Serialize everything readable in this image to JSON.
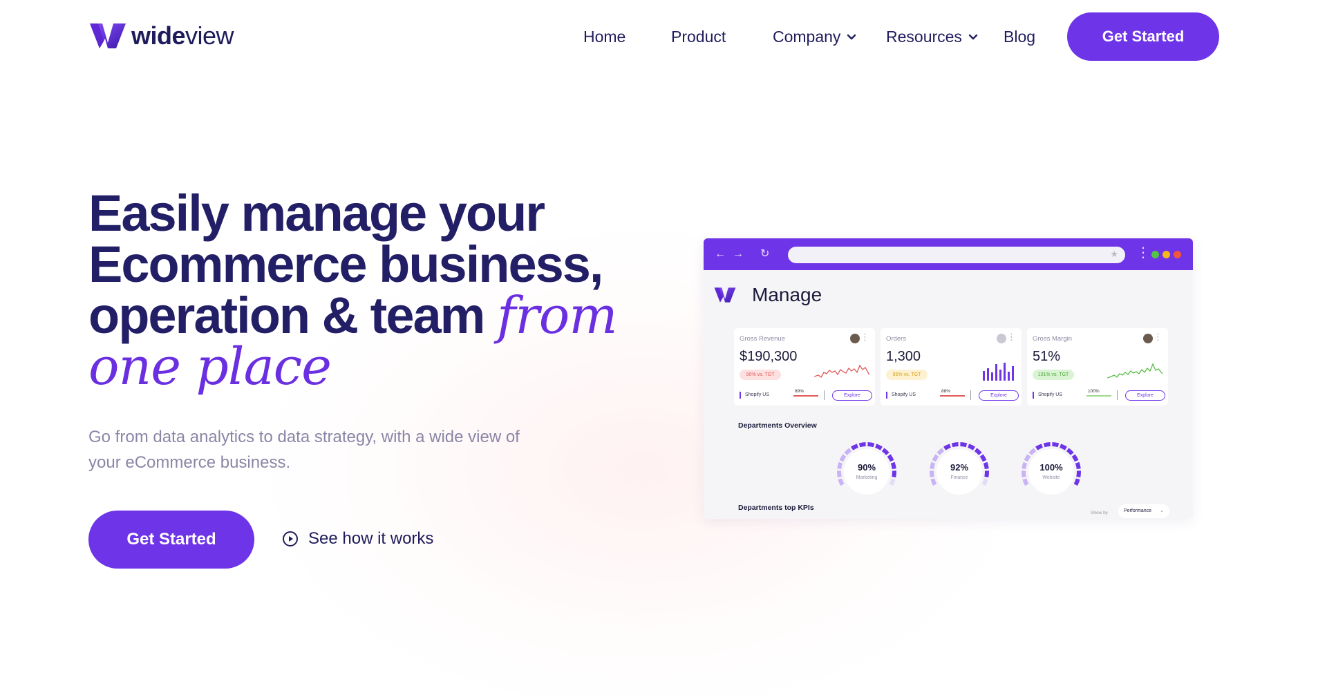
{
  "brand": {
    "name_bold": "wide",
    "name_light": "view"
  },
  "nav": {
    "links": [
      {
        "label": "Home",
        "has_dropdown": false
      },
      {
        "label": "Product",
        "has_dropdown": false
      },
      {
        "label": "Company",
        "has_dropdown": true
      },
      {
        "label": "Resources",
        "has_dropdown": true
      },
      {
        "label": "Blog",
        "has_dropdown": false
      }
    ],
    "cta_label": "Get Started"
  },
  "hero": {
    "title_line1": "Easily manage your",
    "title_line2": "Ecommerce business,",
    "title_line3": "operation & team",
    "title_accent1": "from",
    "title_accent2": "one place",
    "subtitle": "Go from data analytics to data strategy, with a wide view of your eCommerce business.",
    "cta_label": "Get Started",
    "secondary_cta_label": "See how it works"
  },
  "dashboard": {
    "title": "Manage",
    "cards": [
      {
        "label": "Gross Revenue",
        "value": "$190,300",
        "pill": "90% vs. TGT",
        "source": "Shopify US",
        "pct": "89%",
        "explore": "Explore"
      },
      {
        "label": "Orders",
        "value": "1,300",
        "pill": "95% vs. TGT",
        "source": "Shopify US",
        "pct": "88%",
        "explore": "Explore"
      },
      {
        "label": "Gross Margin",
        "value": "51%",
        "pill": "101% vs. TGT",
        "source": "Shopify US",
        "pct": "100%",
        "explore": "Explore"
      }
    ],
    "departments_overview_label": "Departments Overview",
    "gauges": [
      {
        "value": "90%",
        "name": "Marketing",
        "fraction": 0.9
      },
      {
        "value": "92%",
        "name": "Finance",
        "fraction": 0.92
      },
      {
        "value": "100%",
        "name": "Website",
        "fraction": 1.0
      }
    ],
    "departments_kpis_label": "Departments top KPIs",
    "show_by_label": "Show by",
    "show_by_value": "Performance"
  },
  "colors": {
    "primary": "#6e34e8",
    "heading": "#231f66",
    "accent_text": "#6a2fe0",
    "body_text": "#8a86a6",
    "revenue_red": "#e05a5a",
    "orders_purple": "#6e34e8",
    "margin_green": "#55bb44"
  }
}
